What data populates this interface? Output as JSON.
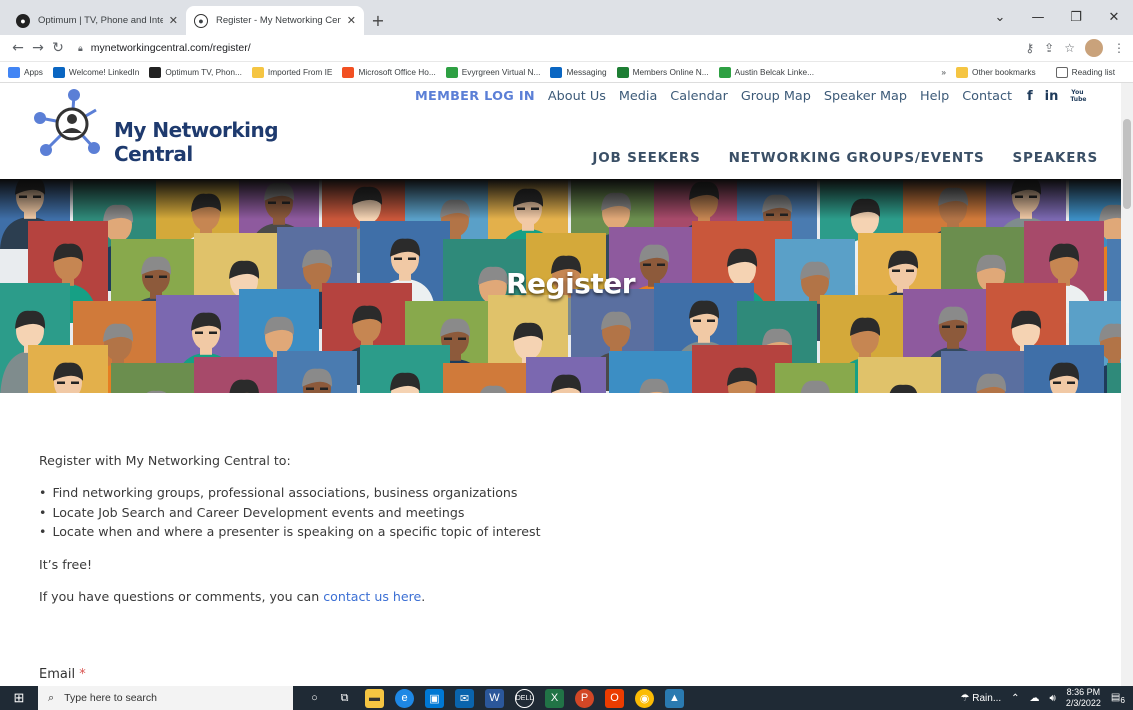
{
  "browser": {
    "tabs": [
      {
        "title": "Optimum | TV, Phone and Intern",
        "active": false
      },
      {
        "title": "Register - My Networking Centra",
        "active": true
      }
    ],
    "new_tab": "+",
    "url": "mynetworkingcentral.com/register/",
    "bookmarks": [
      {
        "label": "Apps",
        "color": "#4285f4"
      },
      {
        "label": "Welcome! LinkedIn",
        "color": "#0a66c2"
      },
      {
        "label": "Optimum TV, Phon...",
        "color": "#222222"
      },
      {
        "label": "Imported From IE",
        "color": "#f5c542"
      },
      {
        "label": "Microsoft Office Ho...",
        "color": "#f25022"
      },
      {
        "label": "Evyrgreen Virtual N...",
        "color": "#2ea043"
      },
      {
        "label": "Messaging",
        "color": "#0a66c2"
      },
      {
        "label": "Members Online N...",
        "color": "#1e7e34"
      },
      {
        "label": "Austin Belcak Linke...",
        "color": "#2ea043"
      }
    ],
    "bookmarks_overflow": "»",
    "other_bookmarks": "Other bookmarks",
    "reading_list": "Reading list"
  },
  "site": {
    "logo_text": "My Networking Central",
    "top_nav": [
      "MEMBER LOG IN",
      "About Us",
      "Media",
      "Calendar",
      "Group Map",
      "Speaker Map",
      "Help",
      "Contact"
    ],
    "social": [
      "f",
      "in",
      "You Tube"
    ],
    "main_nav": [
      "JOB SEEKERS",
      "NETWORKING GROUPS/EVENTS",
      "SPEAKERS"
    ],
    "hero_title": "Register"
  },
  "content": {
    "intro": "Register with My Networking Central to:",
    "bullets": [
      "Find networking groups, professional associations, business organizations",
      "Locate Job Search and Career Development events and meetings",
      "Locate when and where a presenter is speaking on a specific topic of interest"
    ],
    "free": "It’s free!",
    "questions_prefix": "If you have questions or comments, you can ",
    "contact_link": "contact us here",
    "questions_suffix": ".",
    "email_label": "Email",
    "required_mark": "*"
  },
  "taskbar": {
    "search_placeholder": "Type here to search",
    "weather": "Rain...",
    "time": "8:36 PM",
    "date": "2/3/2022",
    "notifications": "6"
  }
}
